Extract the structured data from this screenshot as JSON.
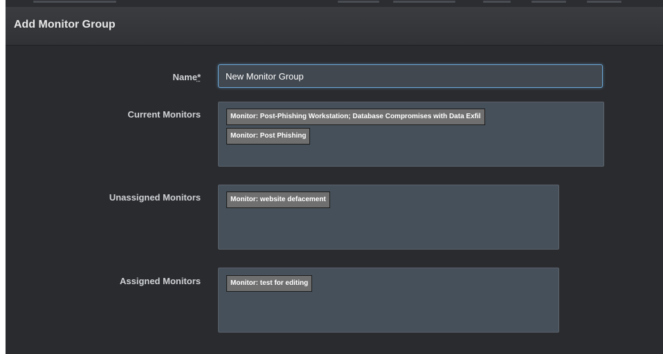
{
  "dialog": {
    "title": "Add Monitor Group"
  },
  "form": {
    "name": {
      "label": "Name",
      "required_mark": "*",
      "value": "New Monitor Group"
    },
    "current_monitors": {
      "label": "Current Monitors",
      "items": [
        "Monitor: Post-Phishing Workstation; Database Compromises with Data Exfil",
        "Monitor: Post Phishing"
      ]
    },
    "unassigned_monitors": {
      "label": "Unassigned Monitors",
      "items": [
        "Monitor: website defacement"
      ]
    },
    "assigned_monitors": {
      "label": "Assigned Monitors",
      "items": [
        "Monitor: test for editing"
      ]
    }
  },
  "colors": {
    "dialog_bg": "#2a2b2e",
    "box_bg": "#46505a",
    "chip_bg": "#6f6f6f",
    "focus_accent": "#6aa6d6"
  }
}
